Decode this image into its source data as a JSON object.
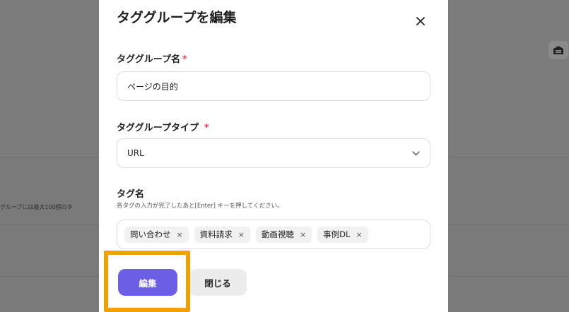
{
  "background": {
    "hint_text": "グループには最大100個のタ"
  },
  "modal": {
    "title": "タググループを編集",
    "group_name": {
      "label": "タググループ名",
      "required_mark": "*",
      "value": "ページの目的"
    },
    "group_type": {
      "label": "タググループタイプ",
      "required_mark": "*",
      "selected": "URL"
    },
    "tags": {
      "label": "タグ名",
      "hint": "各タグの入力が完了したあと[Enter] キーを押してください。",
      "items": [
        "問い合わせ",
        "資料請求",
        "動画視聴",
        "事例DL"
      ],
      "remove_glyph": "×"
    },
    "buttons": {
      "save": "編集",
      "close": "閉じる"
    }
  },
  "colors": {
    "primary": "#6c5fe6",
    "required": "#e0445a",
    "highlight": "#f0a000",
    "overlay": "#7a7a7a"
  },
  "icons": {
    "close": "close-icon",
    "select": "chevron-down-icon",
    "bg_button": "garage-icon"
  }
}
